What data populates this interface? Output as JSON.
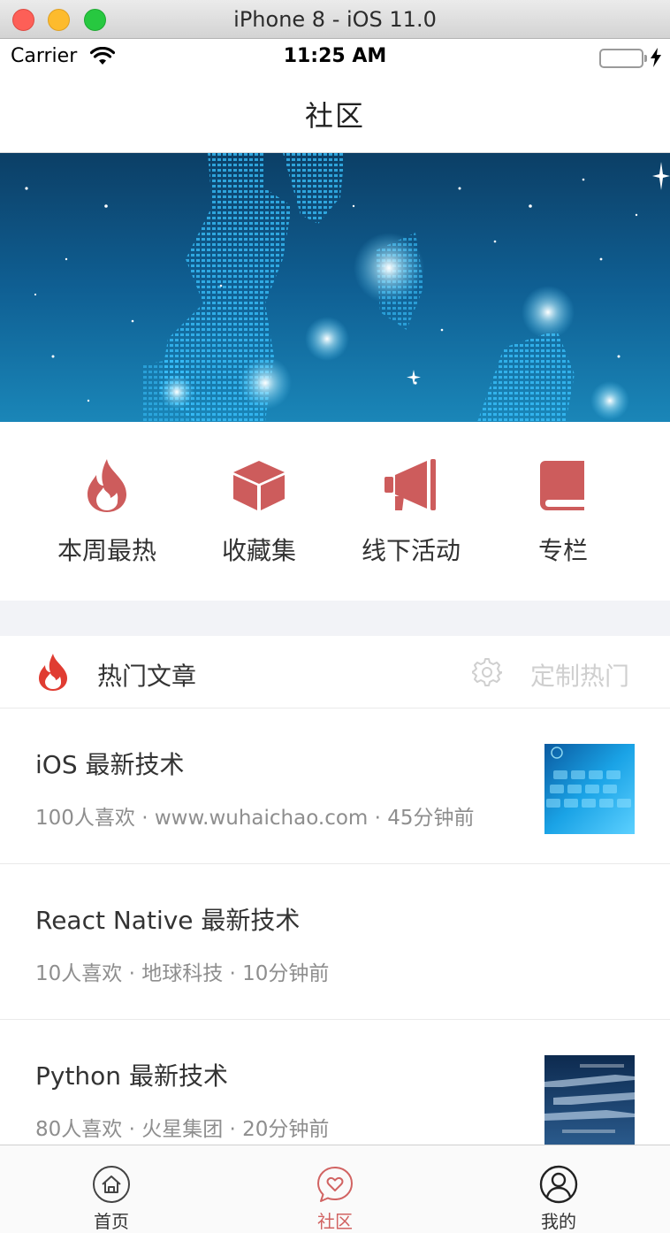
{
  "window": {
    "title": "iPhone 8 - iOS 11.0"
  },
  "status_bar": {
    "carrier": "Carrier",
    "time": "11:25 AM"
  },
  "nav": {
    "title": "社区"
  },
  "quick_entries": [
    {
      "label": "本周最热",
      "icon": "flame-icon"
    },
    {
      "label": "收藏集",
      "icon": "cube-icon"
    },
    {
      "label": "线下活动",
      "icon": "megaphone-icon"
    },
    {
      "label": "专栏",
      "icon": "book-icon"
    }
  ],
  "hot_section": {
    "title": "热门文章",
    "custom_label": "定制热门"
  },
  "articles": [
    {
      "title": "iOS 最新技术",
      "meta": "100人喜欢 · www.wuhaichao.com · 45分钟前",
      "has_thumb": true
    },
    {
      "title": "React Native 最新技术",
      "meta": "10人喜欢 · 地球科技 · 10分钟前",
      "has_thumb": false
    },
    {
      "title": "Python 最新技术",
      "meta": "80人喜欢 · 火星集团 · 20分钟前",
      "has_thumb": true
    }
  ],
  "tabs": [
    {
      "label": "首页",
      "icon": "home-icon",
      "active": false
    },
    {
      "label": "社区",
      "icon": "chat-heart-icon",
      "active": true
    },
    {
      "label": "我的",
      "icon": "user-icon",
      "active": false
    }
  ],
  "colors": {
    "accent": "#d16362",
    "icon_red": "#cd5c5c",
    "hot_red": "#e03c32"
  }
}
